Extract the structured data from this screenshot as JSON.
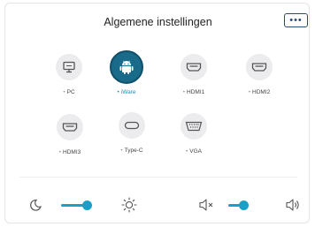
{
  "header": {
    "title": "Algemene instellingen",
    "more_label": "•••"
  },
  "sources": [
    {
      "label": "PC",
      "icon": "monitor-icon",
      "active": false
    },
    {
      "label": "iWare",
      "icon": "android-icon",
      "active": true
    },
    {
      "label": "HDMI1",
      "icon": "hdmi-icon",
      "active": false
    },
    {
      "label": "HDMI2",
      "icon": "hdmi-icon",
      "active": false
    },
    {
      "label": "HDMI3",
      "icon": "hdmi-icon",
      "active": false
    },
    {
      "label": "Type-C",
      "icon": "usb-c-icon",
      "active": false
    },
    {
      "label": "VGA",
      "icon": "vga-icon",
      "active": false
    }
  ],
  "brightness": {
    "value": 0.5,
    "low_icon": "moon-icon",
    "high_icon": "sun-icon"
  },
  "volume": {
    "value": 0.3,
    "low_icon": "mute-icon",
    "high_icon": "speaker-icon"
  },
  "colors": {
    "accent": "#1aa0c8",
    "active_source": "#1a6b8a"
  }
}
